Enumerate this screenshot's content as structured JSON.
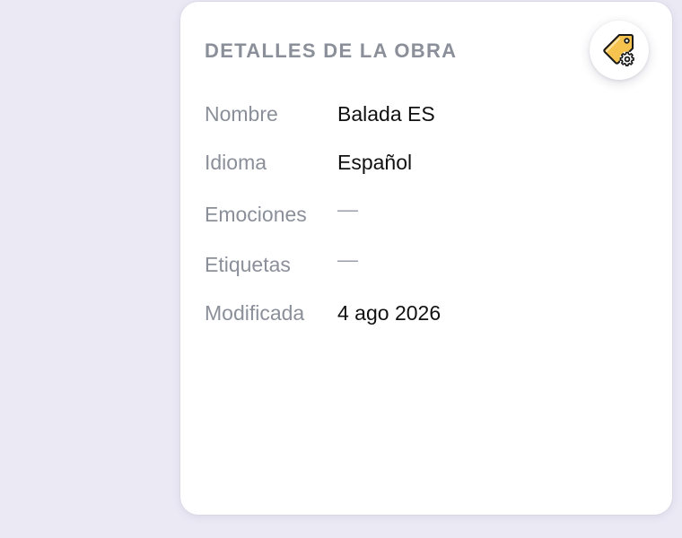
{
  "card": {
    "title": "DETALLES DE LA OBRA",
    "tag_settings_icon": "tag-settings-icon",
    "fields": [
      {
        "label": "Nombre",
        "value": "Balada ES"
      },
      {
        "label": "Idioma",
        "value": "Español"
      },
      {
        "label": "Emociones",
        "value": "—"
      },
      {
        "label": "Etiquetas",
        "value": "—"
      },
      {
        "label": "Modificada",
        "value": "4 ago 2026"
      }
    ]
  },
  "colors": {
    "background": "#ebe9f4",
    "card": "#ffffff",
    "label": "#8a8f99",
    "value": "#111111",
    "tag_fill": "#f6c34f"
  }
}
